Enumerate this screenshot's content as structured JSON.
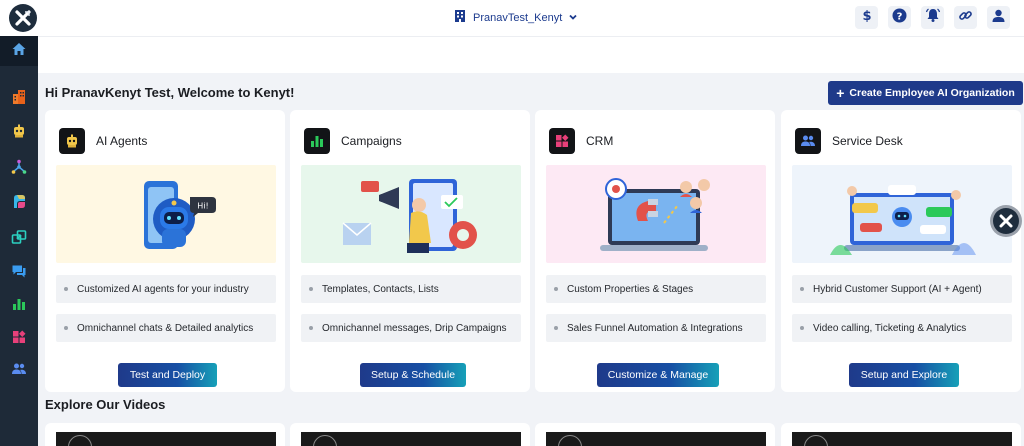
{
  "header": {
    "logo_icon": "kenyt-x-logo",
    "org_name": "PranavTest_Kenyt",
    "org_icon": "building-icon",
    "actions": [
      {
        "name": "billing",
        "icon": "dollar-icon"
      },
      {
        "name": "help",
        "icon": "question-icon"
      },
      {
        "name": "notifications",
        "icon": "bell-icon"
      },
      {
        "name": "links",
        "icon": "link-icon"
      },
      {
        "name": "profile",
        "icon": "user-icon"
      }
    ]
  },
  "sidebar": {
    "items": [
      {
        "name": "home",
        "icon": "home-icon",
        "active": true
      },
      {
        "name": "organization",
        "icon": "building-icon"
      },
      {
        "name": "ai-agents",
        "icon": "robot-icon"
      },
      {
        "name": "workflows",
        "icon": "network-icon"
      },
      {
        "name": "copilot",
        "icon": "copilot-icon"
      },
      {
        "name": "integrations",
        "icon": "integration-icon"
      },
      {
        "name": "conversations",
        "icon": "chat-icon"
      },
      {
        "name": "campaigns",
        "icon": "bar-chart-icon"
      },
      {
        "name": "crm",
        "icon": "crm-icon"
      },
      {
        "name": "service-desk",
        "icon": "users-icon"
      }
    ]
  },
  "welcome": {
    "text": "Hi PranavKenyt Test, Welcome to Kenyt!",
    "create_button": "Create Employee AI Organization"
  },
  "cards": [
    {
      "title": "AI Agents",
      "icon": "robot-icon",
      "features": [
        "Customized AI agents for your industry",
        "Omnichannel chats & Detailed analytics"
      ],
      "button": "Test and Deploy",
      "illustration_text": "Hi!"
    },
    {
      "title": "Campaigns",
      "icon": "bar-chart-icon",
      "features": [
        "Templates, Contacts, Lists",
        "Omnichannel messages, Drip Campaigns"
      ],
      "button": "Setup & Schedule"
    },
    {
      "title": "CRM",
      "icon": "crm-icon",
      "features": [
        "Custom Properties & Stages",
        "Sales Funnel Automation & Integrations"
      ],
      "button": "Customize & Manage"
    },
    {
      "title": "Service Desk",
      "icon": "users-icon",
      "features": [
        "Hybrid Customer Support (AI + Agent)",
        "Video calling, Ticketing & Analytics"
      ],
      "button": "Setup and Explore"
    }
  ],
  "explore": {
    "title": "Explore Our Videos"
  },
  "colors": {
    "sidebar_bg": "#1e2a38",
    "primary": "#1f3a8a",
    "accent_teal": "#16a0b8",
    "page_bg": "#f1f3f7"
  }
}
